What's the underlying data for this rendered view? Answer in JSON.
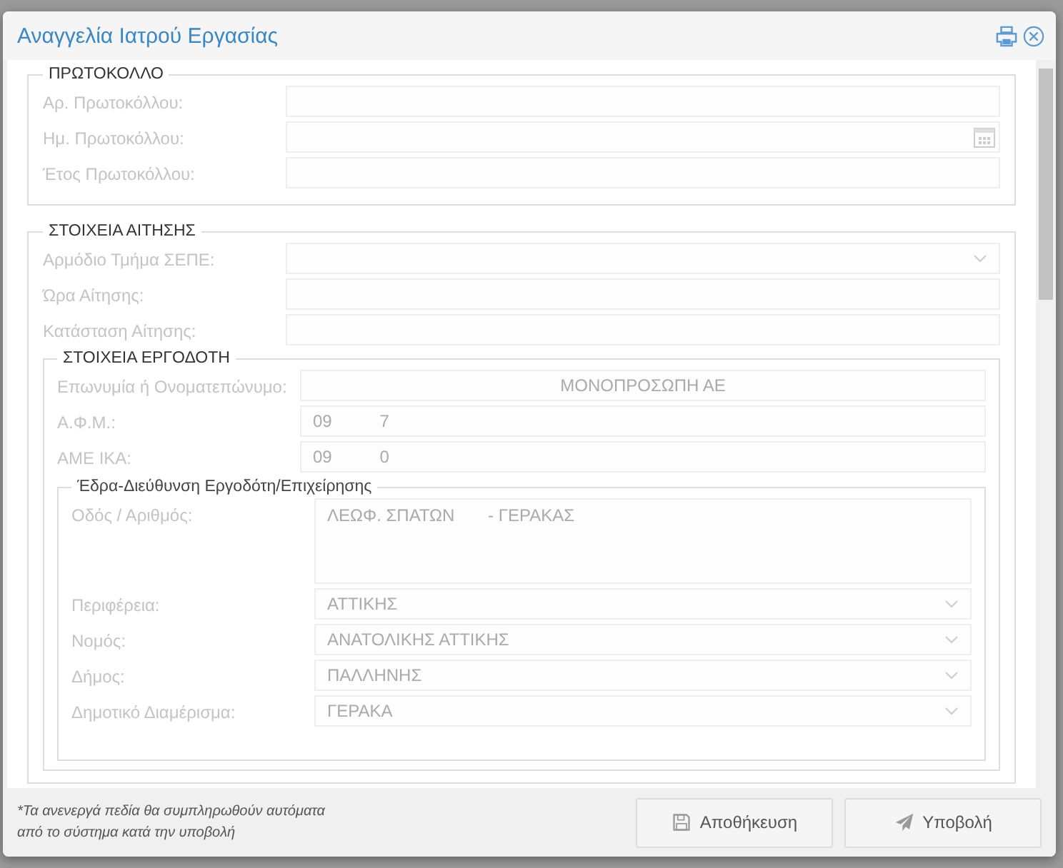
{
  "window": {
    "title": "Αναγγελία Ιατρού Εργασίας"
  },
  "sections": [
    {
      "legend": "ΠΡΩΤΟΚΟΛΛΟ",
      "fields": [
        {
          "label": "Αρ. Πρωτοκόλλου:",
          "kind": "text",
          "disabled": true
        },
        {
          "label": "Ημ. Πρωτοκόλλου:",
          "kind": "date",
          "disabled": true
        },
        {
          "label": "Έτος Πρωτοκόλλου:",
          "kind": "text",
          "disabled": true
        }
      ]
    },
    {
      "legend": "ΣΤΟΙΧΕΙΑ ΑΙΤΗΣΗΣ",
      "fields": [
        {
          "label": "Αρμόδιο Τμήμα ΣΕΠΕ:",
          "kind": "select",
          "disabled": true
        },
        {
          "label": "Ώρα Αίτησης:",
          "kind": "text",
          "disabled": true
        },
        {
          "label": "Κατάσταση Αίτησης:",
          "kind": "text",
          "disabled": true
        }
      ],
      "subsection": {
        "legend": "ΣΤΟΙΧΕΙΑ ΕΡΓΟΔΟΤΗ",
        "fields": [
          {
            "label": "Επωνυμία ή Ονοματεπώνυμο:",
            "kind": "centered",
            "value": "ΜΟΝΟΠΡΟΣΩΠΗ ΑΕ",
            "disabled": true
          },
          {
            "label": "Α.Φ.Μ.:",
            "kind": "text",
            "value": "09          7",
            "disabled": true
          },
          {
            "label": "ΑΜΕ ΙΚΑ:",
            "kind": "text",
            "value": "09          0",
            "disabled": true
          }
        ],
        "subsection": {
          "legend": "Έδρα-Διεύθυνση Εργοδότη/Επιχείρησης",
          "fields": [
            {
              "label": "Οδός / Αριθμός:",
              "kind": "textarea",
              "value": "ΛΕΩΦ. ΣΠΑΤΩΝ       - ΓΕΡΑΚΑΣ",
              "disabled": true
            },
            {
              "label": "Περιφέρεια:",
              "kind": "select",
              "value": "ΑΤΤΙΚΗΣ",
              "disabled": true
            },
            {
              "label": "Νομός:",
              "kind": "select",
              "value": "ΑΝΑΤΟΛΙΚΗΣ ΑΤΤΙΚΗΣ",
              "disabled": true
            },
            {
              "label": "Δήμος:",
              "kind": "select",
              "value": "ΠΑΛΛΗΝΗΣ",
              "disabled": true
            },
            {
              "label": "Δημοτικό Διαμέρισμα:",
              "kind": "select",
              "value": "ΓΕΡΑΚΑ",
              "disabled": true
            }
          ]
        }
      }
    }
  ],
  "footer": {
    "note": "*Τα ανενεργά πεδία θα συμπληρωθούν αυτόματα από το σύστημα κατά την υποβολή",
    "buttons": [
      {
        "label": "Αποθήκευση",
        "kind": "save"
      },
      {
        "label": "Υποβολή",
        "kind": "submit"
      }
    ]
  }
}
